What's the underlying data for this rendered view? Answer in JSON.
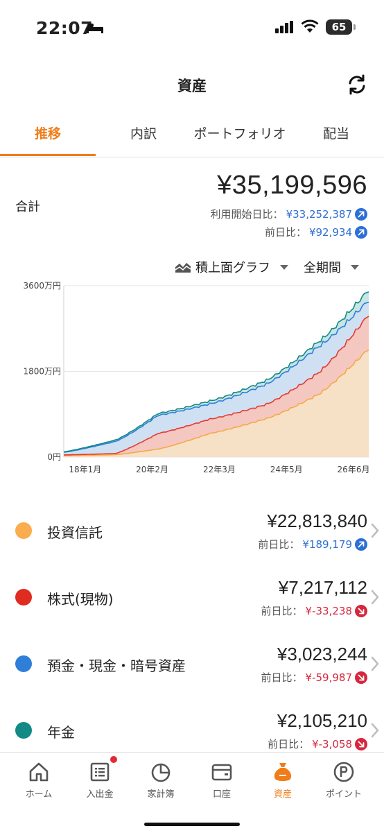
{
  "status_bar": {
    "time": "22:07",
    "battery": "65"
  },
  "header": {
    "title": "資産"
  },
  "tabs": [
    {
      "label": "推移",
      "active": true
    },
    {
      "label": "内訳",
      "active": false
    },
    {
      "label": "ポートフォリオ",
      "active": false
    },
    {
      "label": "配当",
      "active": false
    }
  ],
  "summary": {
    "total_label": "合計",
    "total_value": "¥35,199,596",
    "since_start_label": "利用開始日比：",
    "since_start_value": "¥33,252,387",
    "day_label": "前日比：",
    "day_value": "¥92,934"
  },
  "chart_controls": {
    "chart_type": "積上面グラフ",
    "period": "全期間"
  },
  "chart_data": {
    "type": "area",
    "stacked": true,
    "x": [
      "18年1月",
      "20年2月",
      "22年3月",
      "24年5月",
      "26年6月"
    ],
    "y_ticks": [
      "3600万円",
      "1800万円",
      "0円"
    ],
    "ylim": [
      0,
      3600
    ],
    "series": [
      {
        "name": "投資信託",
        "color": "#f5a94a",
        "values": [
          30,
          50,
          170,
          500,
          800,
          1300,
          2280
        ]
      },
      {
        "name": "株式(現物)",
        "color": "#e33b2f",
        "values": [
          45,
          75,
          500,
          800,
          1100,
          1750,
          3000
        ]
      },
      {
        "name": "預金・現金・暗号資産",
        "color": "#2f7fd8",
        "values": [
          100,
          330,
          880,
          1120,
          1520,
          2300,
          3300
        ]
      },
      {
        "name": "年金",
        "color": "#138a86",
        "values": [
          110,
          360,
          920,
          1180,
          1600,
          2400,
          3520
        ]
      }
    ],
    "x_points": [
      0,
      0.17,
      0.31,
      0.48,
      0.66,
      0.83,
      1.0
    ]
  },
  "assets": [
    {
      "name": "投資信託",
      "color": "#f9ad4f",
      "amount": "¥22,813,840",
      "delta_label": "前日比：",
      "delta": "¥189,179",
      "direction": "up"
    },
    {
      "name": "株式(現物)",
      "color": "#e02b20",
      "amount": "¥7,217,112",
      "delta_label": "前日比：",
      "delta": "¥-33,238",
      "direction": "down"
    },
    {
      "name": "預金・現金・暗号資産",
      "color": "#2f7fd8",
      "amount": "¥3,023,244",
      "delta_label": "前日比：",
      "delta": "¥-59,987",
      "direction": "down"
    },
    {
      "name": "年金",
      "color": "#138a86",
      "amount": "¥2,105,210",
      "delta_label": "前日比：",
      "delta": "¥-3,058",
      "direction": "down"
    }
  ],
  "colors": {
    "accent": "#ef7d1a",
    "up": "#2c6fd6",
    "down": "#d7263d"
  },
  "bottom_nav": [
    {
      "label": "ホーム",
      "icon": "home-icon"
    },
    {
      "label": "入出金",
      "icon": "receipt-icon"
    },
    {
      "label": "家計簿",
      "icon": "pie-chart-icon"
    },
    {
      "label": "口座",
      "icon": "wallet-icon"
    },
    {
      "label": "資産",
      "icon": "money-bag-icon",
      "active": true
    },
    {
      "label": "ポイント",
      "icon": "points-icon"
    }
  ]
}
